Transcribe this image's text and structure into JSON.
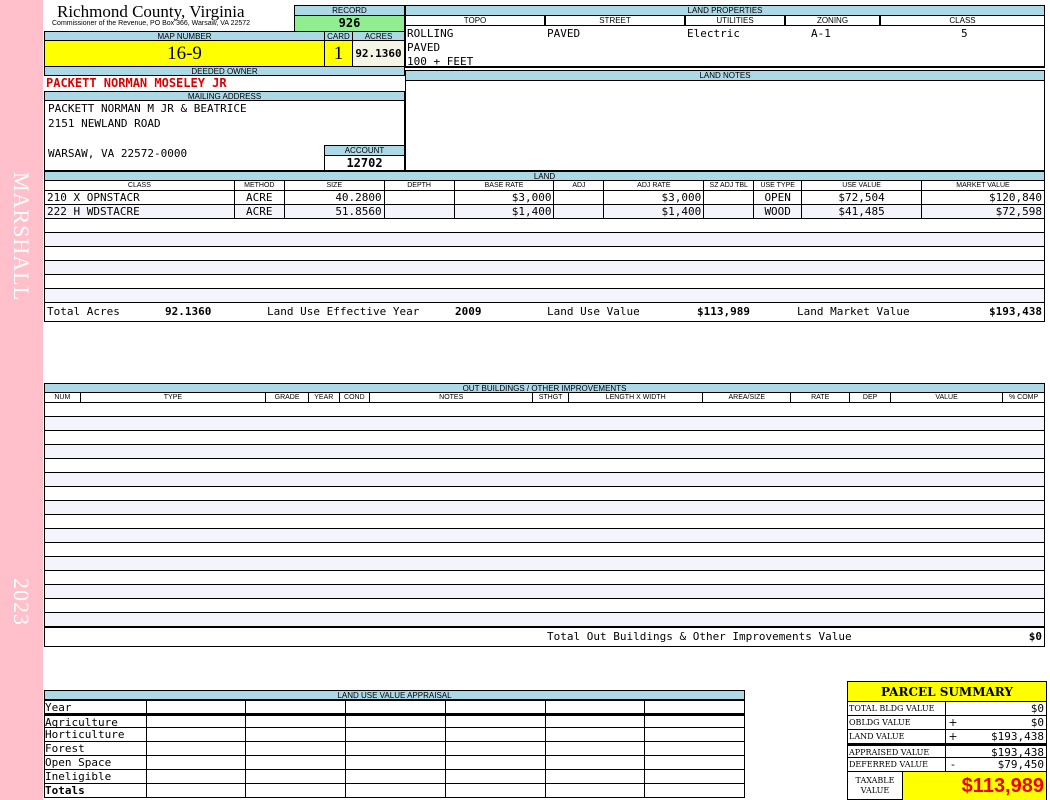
{
  "side": {
    "district": "MARSHALL",
    "year": "2023"
  },
  "header": {
    "title": "Richmond County, Virginia",
    "subtitle": "Commissioner of the Revenue, PO Box 366, Warsaw, VA 22572"
  },
  "record": {
    "label": "RECORD",
    "value": "926"
  },
  "map": {
    "map_label": "MAP NUMBER",
    "map_value": "16-9",
    "card_label": "CARD",
    "card_value": "1",
    "acres_label": "ACRES",
    "acres_value": "92.1360"
  },
  "owner": {
    "label": "DEEDED OWNER",
    "value": "PACKETT NORMAN MOSELEY JR"
  },
  "mailing": {
    "label": "MAILING ADDRESS",
    "lines": [
      "PACKETT NORMAN M JR & BEATRICE",
      "2151 NEWLAND ROAD",
      "",
      "WARSAW, VA 22572-0000"
    ]
  },
  "account": {
    "label": "ACCOUNT",
    "value": "12702"
  },
  "land_properties": {
    "label": "LAND PROPERTIES",
    "columns": [
      "TOPO",
      "STREET",
      "UTILITIES",
      "ZONING",
      "CLASS"
    ],
    "row1": [
      "ROLLING",
      "PAVED",
      "Electric",
      "A-1",
      "5"
    ],
    "row2": "PAVED",
    "row3": "100 + FEET"
  },
  "land_notes": {
    "label": "LAND NOTES"
  },
  "land": {
    "label": "LAND",
    "columns": [
      "CLASS",
      "METHOD",
      "SIZE",
      "DEPTH",
      "BASE RATE",
      "ADJ",
      "ADJ RATE",
      "SZ ADJ TBL",
      "USE TYPE",
      "USE VALUE",
      "MARKET VALUE"
    ],
    "rows": [
      [
        "210 X OPNSTACR",
        "ACRE",
        "40.2800",
        "",
        "$3,000",
        "",
        "$3,000",
        "",
        "OPEN",
        "$72,504",
        "$120,840"
      ],
      [
        "222 H WDSTACRE",
        "ACRE",
        "51.8560",
        "",
        "$1,400",
        "",
        "$1,400",
        "",
        "WOOD",
        "$41,485",
        "$72,598"
      ]
    ],
    "totals": {
      "acres_label": "Total Acres",
      "acres": "92.1360",
      "year_label": "Land Use Effective Year",
      "year": "2009",
      "use_label": "Land Use Value",
      "use": "$113,989",
      "market_label": "Land Market Value",
      "market": "$193,438"
    }
  },
  "outbuildings": {
    "label": "OUT BUILDINGS / OTHER IMPROVEMENTS",
    "columns": [
      "NUM",
      "TYPE",
      "GRADE",
      "YEAR",
      "COND",
      "NOTES",
      "STHGT",
      "LENGTH X WIDTH",
      "AREA/SIZE",
      "RATE",
      "DEP",
      "VALUE",
      "% COMP"
    ],
    "total_label": "Total Out Buildings & Other Improvements Value",
    "total": "$0"
  },
  "appraisal": {
    "label": "LAND USE VALUE APPRAISAL",
    "rows": [
      "Year",
      "Agriculture",
      "Horticulture",
      "Forest",
      "Open Space",
      "Ineligible",
      "Totals"
    ]
  },
  "summary": {
    "title": "PARCEL SUMMARY",
    "rows": [
      {
        "label": "TOTAL BLDG VALUE",
        "sign": "",
        "value": "$0"
      },
      {
        "label": "OBLDG VALUE",
        "sign": "+",
        "value": "$0"
      },
      {
        "label": "LAND VALUE",
        "sign": "+",
        "value": "$193,438"
      },
      {
        "label": "APPRAISED VALUE",
        "sign": "",
        "value": "$193,438"
      },
      {
        "label": "DEFERRED VALUE",
        "sign": "-",
        "value": "$79,450"
      }
    ],
    "taxable_label": "TAXABLE VALUE",
    "taxable": "$113,989"
  },
  "colors": {
    "header_blue": "#add8e6",
    "record_green": "#90ee90",
    "highlight_yellow": "#ffff00",
    "owner_red": "#dd0000",
    "band_pink": "#ffc0cb"
  }
}
